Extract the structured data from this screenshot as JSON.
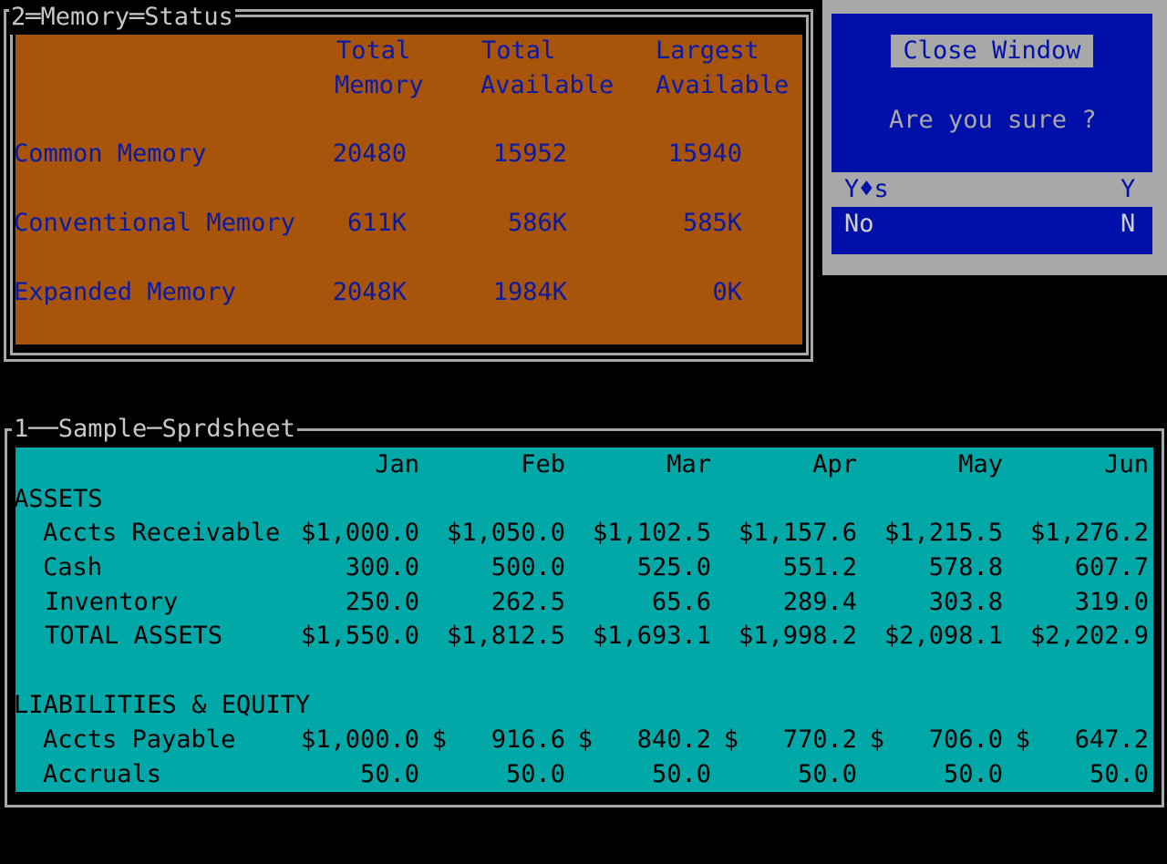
{
  "memory_window": {
    "title": "2═Memory═Status",
    "headers": [
      {
        "line1": "Total",
        "line2": "Memory"
      },
      {
        "line1": "Total",
        "line2": "Available"
      },
      {
        "line1": "Largest",
        "line2": "Available"
      }
    ],
    "rows": [
      {
        "label": "Common Memory",
        "values": [
          "20480",
          "15952",
          "15940"
        ]
      },
      {
        "label": "Conventional Memory",
        "values": [
          "611K",
          "586K",
          "585K"
        ]
      },
      {
        "label": "Expanded Memory",
        "values": [
          "2048K",
          "1984K",
          "0K"
        ]
      }
    ]
  },
  "dialog": {
    "title": "Close Window",
    "question": "Are you sure ?",
    "options": [
      {
        "label": "Y♦s",
        "key": "Y"
      },
      {
        "label": "No",
        "key": "N"
      }
    ]
  },
  "sheet_window": {
    "title": "1──Sample─Sprdsheet",
    "months": [
      "Jan",
      "Feb",
      "Mar",
      "Apr",
      "May",
      "Jun"
    ],
    "sections": [
      {
        "heading": "ASSETS"
      },
      {
        "label": "Accts Receivable",
        "values": [
          "$1,000.0",
          "$1,050.0",
          "$1,102.5",
          "$1,157.6",
          "$1,215.5",
          "$1,276.2"
        ]
      },
      {
        "label": "Cash",
        "values": [
          "300.0",
          "500.0",
          "525.0",
          "551.2",
          "578.8",
          "607.7"
        ]
      },
      {
        "label": "Inventory",
        "values": [
          "250.0",
          "262.5",
          "65.6",
          "289.4",
          "303.8",
          "319.0"
        ]
      },
      {
        "label": "TOTAL ASSETS",
        "values": [
          "$1,550.0",
          "$1,812.5",
          "$1,693.1",
          "$1,998.2",
          "$2,098.1",
          "$2,202.9"
        ]
      },
      {
        "heading": "LIABILITIES & EQUITY"
      },
      {
        "label": "Accts Payable",
        "values": [
          "$1,000.0",
          "$   916.6",
          "$   840.2",
          "$   770.2",
          "$   706.0",
          "$   647.2"
        ]
      },
      {
        "label": "Accruals",
        "values": [
          "50.0",
          "50.0",
          "50.0",
          "50.0",
          "50.0",
          "50.0"
        ]
      }
    ]
  }
}
